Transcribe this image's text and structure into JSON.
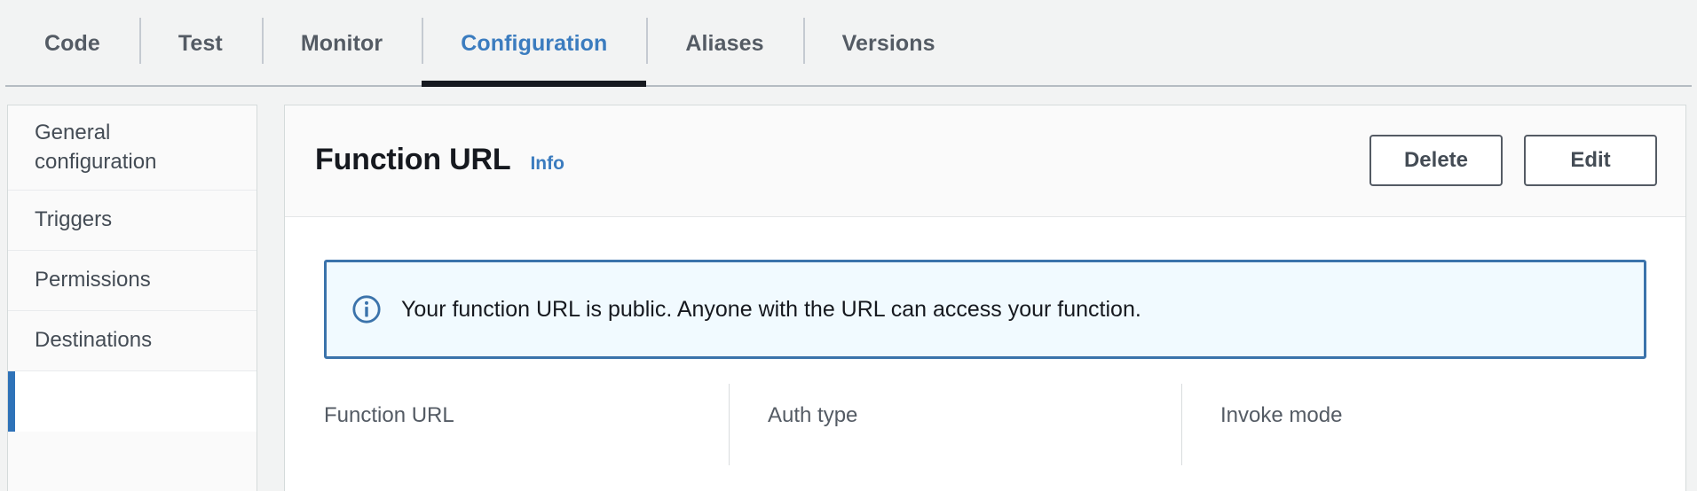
{
  "tabs": [
    {
      "label": "Code",
      "active": false
    },
    {
      "label": "Test",
      "active": false
    },
    {
      "label": "Monitor",
      "active": false
    },
    {
      "label": "Configuration",
      "active": true
    },
    {
      "label": "Aliases",
      "active": false
    },
    {
      "label": "Versions",
      "active": false
    }
  ],
  "sidebar": {
    "items": [
      {
        "label": "General configuration",
        "selected": false,
        "multiline": true
      },
      {
        "label": "Triggers",
        "selected": false,
        "multiline": false
      },
      {
        "label": "Permissions",
        "selected": false,
        "multiline": false
      },
      {
        "label": "Destinations",
        "selected": false,
        "multiline": false
      },
      {
        "label": "",
        "selected": true,
        "multiline": false
      }
    ]
  },
  "panel": {
    "title": "Function URL",
    "info_label": "Info",
    "delete_label": "Delete",
    "edit_label": "Edit",
    "alert": {
      "icon": "info-circle-icon",
      "message": "Your function URL is public. Anyone with the URL can access your function."
    },
    "details": [
      {
        "label": "Function URL"
      },
      {
        "label": "Auth type"
      },
      {
        "label": "Invoke mode"
      }
    ]
  },
  "colors": {
    "accent_blue": "#3b7cbf",
    "selected_bar": "#2e72b8",
    "alert_border": "#3b73ab",
    "alert_bg": "#f1faff",
    "active_tab_underline": "#16191f",
    "page_bg": "#f2f3f3"
  }
}
